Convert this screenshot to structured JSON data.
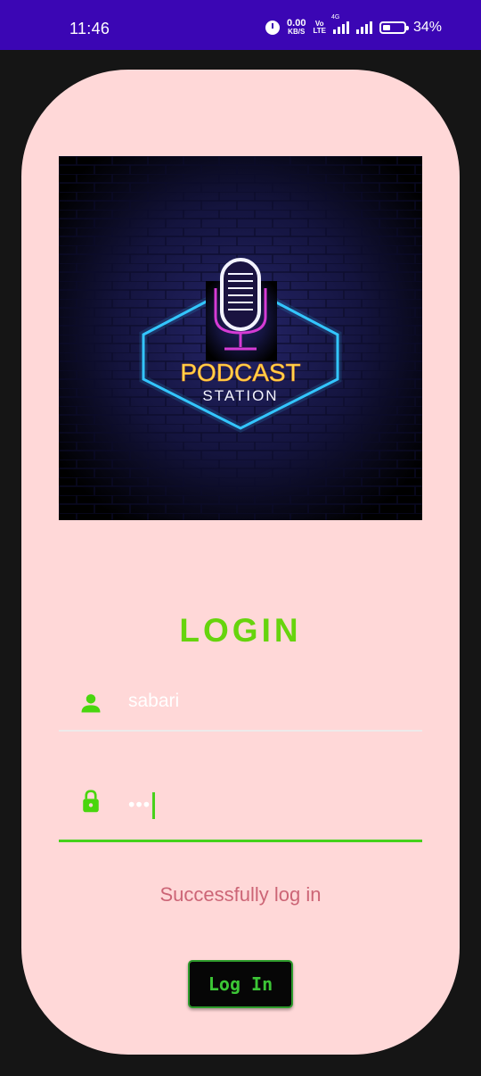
{
  "status_bar": {
    "time": "11:46",
    "net_speed_value": "0.00",
    "net_speed_unit": "KB/S",
    "volte_top": "Vo",
    "volte_bottom": "LTE",
    "network_type": "4G",
    "battery_percent": "34%"
  },
  "banner": {
    "line1": "PODCAST",
    "line2": "STATION"
  },
  "login": {
    "title": "LOGIN",
    "username_value": "sabari",
    "password_value": "•••",
    "status_message": "Successfully log in",
    "button_label": "Log In"
  },
  "colors": {
    "status_bar": "#3b06b4",
    "card_bg": "#ffd8d8",
    "title_green": "#67d40d",
    "active_underline": "#47d11b",
    "message_pink": "#cc6576",
    "button_bg": "#060606"
  }
}
